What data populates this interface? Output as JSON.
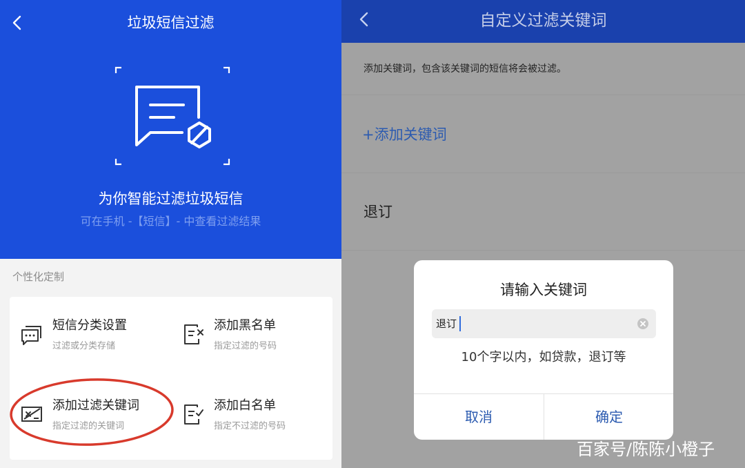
{
  "left": {
    "title": "垃圾短信过滤",
    "headline": "为你智能过滤垃圾短信",
    "subline": "可在手机 -【短信】- 中查看过滤结果",
    "section_label": "个性化定制",
    "options": [
      {
        "title": "短信分类设置",
        "subtitle": "过滤或分类存储",
        "icon": "message-category-icon"
      },
      {
        "title": "添加黑名单",
        "subtitle": "指定过滤的号码",
        "icon": "blacklist-icon"
      },
      {
        "title": "添加过滤关键词",
        "subtitle": "指定过滤的关键词",
        "icon": "keyword-filter-icon"
      },
      {
        "title": "添加白名单",
        "subtitle": "指定不过滤的号码",
        "icon": "whitelist-icon"
      }
    ],
    "colors": {
      "hero_blue": "#1b4fdc",
      "highlight_circle": "#d83a2c"
    }
  },
  "right": {
    "title": "自定义过滤关键词",
    "description": "添加关键词，包含该关键词的短信将会被过滤。",
    "add_keyword_label": "+添加关键词",
    "keywords": [
      "退订"
    ],
    "dialog": {
      "title": "请输入关键词",
      "input_value": "退订",
      "hint": "10个字以内，如贷款，退订等",
      "cancel_label": "取消",
      "confirm_label": "确定"
    },
    "colors": {
      "header_blue": "#1a41ad",
      "action_blue": "#2c5bb0"
    }
  },
  "watermark": "百家号/陈陈小橙子"
}
